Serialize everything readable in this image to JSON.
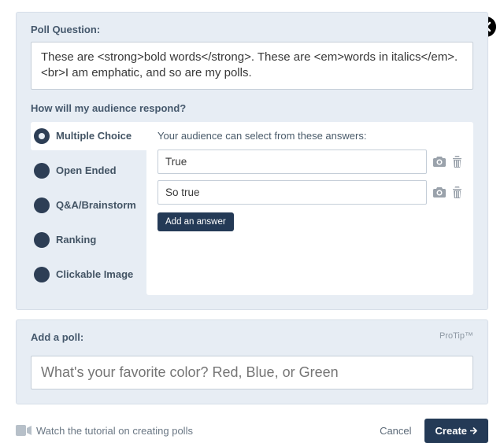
{
  "close": "×",
  "poll_question_label": "Poll Question:",
  "poll_question_text": "These are <strong>bold words</strong>. These are <em>words in italics</em>. <br>I am emphatic, and so are my polls.",
  "respond_label": "How will my audience respond?",
  "types": {
    "multiple_choice": "Multiple Choice",
    "open_ended": "Open Ended",
    "qa_brainstorm": "Q&A/Brainstorm",
    "ranking": "Ranking",
    "clickable_image": "Clickable Image"
  },
  "answers_hint": "Your audience can select from these answers:",
  "answers": [
    {
      "value": "True"
    },
    {
      "value": "So true"
    }
  ],
  "add_answer_label": "Add an answer",
  "add_poll_label": "Add a poll:",
  "protip": "ProTip™",
  "add_poll_placeholder": "What's your favorite color? Red, Blue, or Green",
  "tutorial_text": "Watch the tutorial on creating polls",
  "cancel_label": "Cancel",
  "create_label": "Create"
}
